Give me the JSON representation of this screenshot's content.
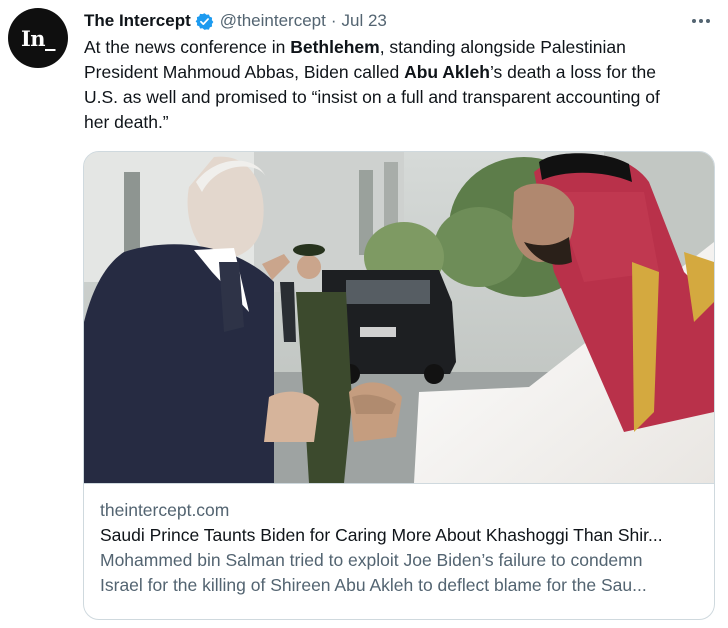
{
  "author": {
    "avatar_text": "In_",
    "name": "The Intercept",
    "handle": "@theintercept",
    "separator": "·",
    "date": "Jul 23",
    "verified": true
  },
  "tweet": {
    "lines": [
      [
        {
          "text": "At the news conference in ",
          "bold": false
        },
        {
          "text": "Bethlehem",
          "bold": true
        },
        {
          "text": ", standing alongside Palestinian",
          "bold": false
        }
      ],
      [
        {
          "text": "President Mahmoud Abbas, Biden called ",
          "bold": false
        },
        {
          "text": "Abu Akleh",
          "bold": true
        },
        {
          "text": "’s death a loss for the",
          "bold": false
        }
      ],
      [
        {
          "text": "U.S. as well and promised to “insist on a full and transparent accounting of",
          "bold": false
        }
      ],
      [
        {
          "text": "her death.”",
          "bold": false
        }
      ]
    ]
  },
  "card": {
    "domain": "theintercept.com",
    "title": "Saudi Prince Taunts Biden for Caring More About Khashoggi Than Shir...",
    "description_lines": [
      "Mohammed bin Salman tried to exploit Joe Biden’s failure to condemn",
      "Israel for the killing of Shireen Abu Akleh to deflect blame for the Sau..."
    ]
  },
  "colors": {
    "text": "#0f1419",
    "secondary": "#536471",
    "verified_blue": "#1d9bf0",
    "border": "#cfd9de"
  },
  "icons": {
    "verified": "verified-badge-icon",
    "more": "more-options-icon"
  }
}
